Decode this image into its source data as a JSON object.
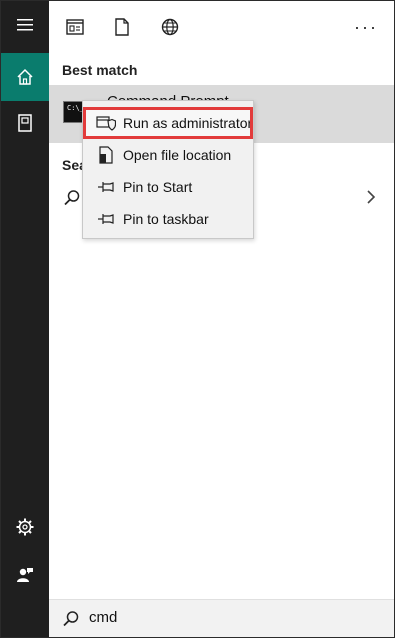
{
  "sidebar": {
    "items": [
      {
        "icon": "hamburger-menu-icon"
      },
      {
        "icon": "home-icon"
      },
      {
        "icon": "documents-icon"
      },
      {
        "icon": "settings-gear-icon"
      },
      {
        "icon": "user-feedback-icon"
      }
    ]
  },
  "toolbar": {
    "icons": [
      "apps-icon",
      "documents-icon",
      "web-icon"
    ],
    "more_label": "···"
  },
  "best_match": {
    "section_label": "Best match",
    "title": "Command Prompt"
  },
  "search_section": {
    "label": "Sea"
  },
  "context_menu": {
    "items": [
      {
        "label": "Run as administrator",
        "icon": "shield-run-icon",
        "highlighted": true
      },
      {
        "label": "Open file location",
        "icon": "file-location-icon"
      },
      {
        "label": "Pin to Start",
        "icon": "pin-icon"
      },
      {
        "label": "Pin to taskbar",
        "icon": "pin-icon"
      }
    ]
  },
  "search_bar": {
    "query": "cmd"
  },
  "colors": {
    "rail": "#1f1f1f",
    "accent": "#0a7c6d",
    "highlight_border": "#e23b3b",
    "selected_row": "#dadada"
  }
}
